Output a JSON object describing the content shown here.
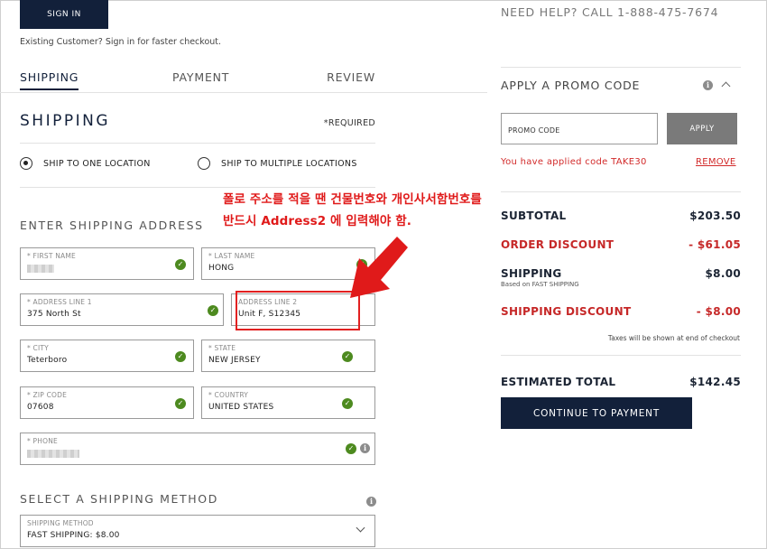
{
  "header": {
    "signin_label": "SIGN IN",
    "existing_text": "Existing Customer? Sign in for faster checkout.",
    "help_text": "NEED HELP? CALL 1-888-475-7674"
  },
  "steps": [
    "SHIPPING",
    "PAYMENT",
    "REVIEW"
  ],
  "shipping": {
    "title": "SHIPPING",
    "required_text": "*REQUIRED",
    "options": [
      "SHIP TO ONE LOCATION",
      "SHIP TO MULTIPLE LOCATIONS"
    ],
    "selected_option": "SHIP TO ONE LOCATION",
    "enter_address_title": "ENTER SHIPPING ADDRESS",
    "fields": {
      "first_name": {
        "label": "* FIRST NAME",
        "value": ""
      },
      "last_name": {
        "label": "* LAST NAME",
        "value": "HONG"
      },
      "address1": {
        "label": "* ADDRESS LINE 1",
        "value": "375 North St"
      },
      "address2": {
        "label": "ADDRESS LINE 2",
        "value": "Unit F, S12345"
      },
      "city": {
        "label": "* CITY",
        "value": "Teterboro"
      },
      "state": {
        "label": "* STATE",
        "value": "NEW JERSEY"
      },
      "zip": {
        "label": "* ZIP CODE",
        "value": "07608"
      },
      "country": {
        "label": "* COUNTRY",
        "value": "UNITED STATES"
      },
      "phone": {
        "label": "* PHONE",
        "value": ""
      }
    },
    "method_title": "SELECT A SHIPPING METHOD",
    "method_label": "SHIPPING METHOD",
    "method_value": "FAST SHIPPING: $8.00"
  },
  "annotation": {
    "line1": "폴로 주소를 적을 땐 건물번호와 개인사서함번호를",
    "line2": "반드시 Address2 에 입력해야 함."
  },
  "promo": {
    "heading": "APPLY A PROMO CODE",
    "placeholder": "PROMO CODE",
    "apply_label": "APPLY",
    "applied_text": "You have applied code TAKE30",
    "remove_label": "REMOVE"
  },
  "summary": {
    "subtotal_label": "SUBTOTAL",
    "subtotal": "$203.50",
    "order_discount_label": "ORDER DISCOUNT",
    "order_discount": "- $61.05",
    "shipping_label": "SHIPPING",
    "shipping": "$8.00",
    "shipping_sub": "Based on FAST SHIPPING",
    "shipping_discount_label": "SHIPPING DISCOUNT",
    "shipping_discount": "- $8.00",
    "taxes_note": "Taxes will be shown at end of checkout",
    "total_label": "ESTIMATED TOTAL",
    "total": "$142.45",
    "continue_label": "CONTINUE TO PAYMENT"
  },
  "colors": {
    "navy": "#12203a",
    "discount_red": "#c62828",
    "check_green": "#4d8a1f",
    "annotation_red": "#e01a1a"
  }
}
